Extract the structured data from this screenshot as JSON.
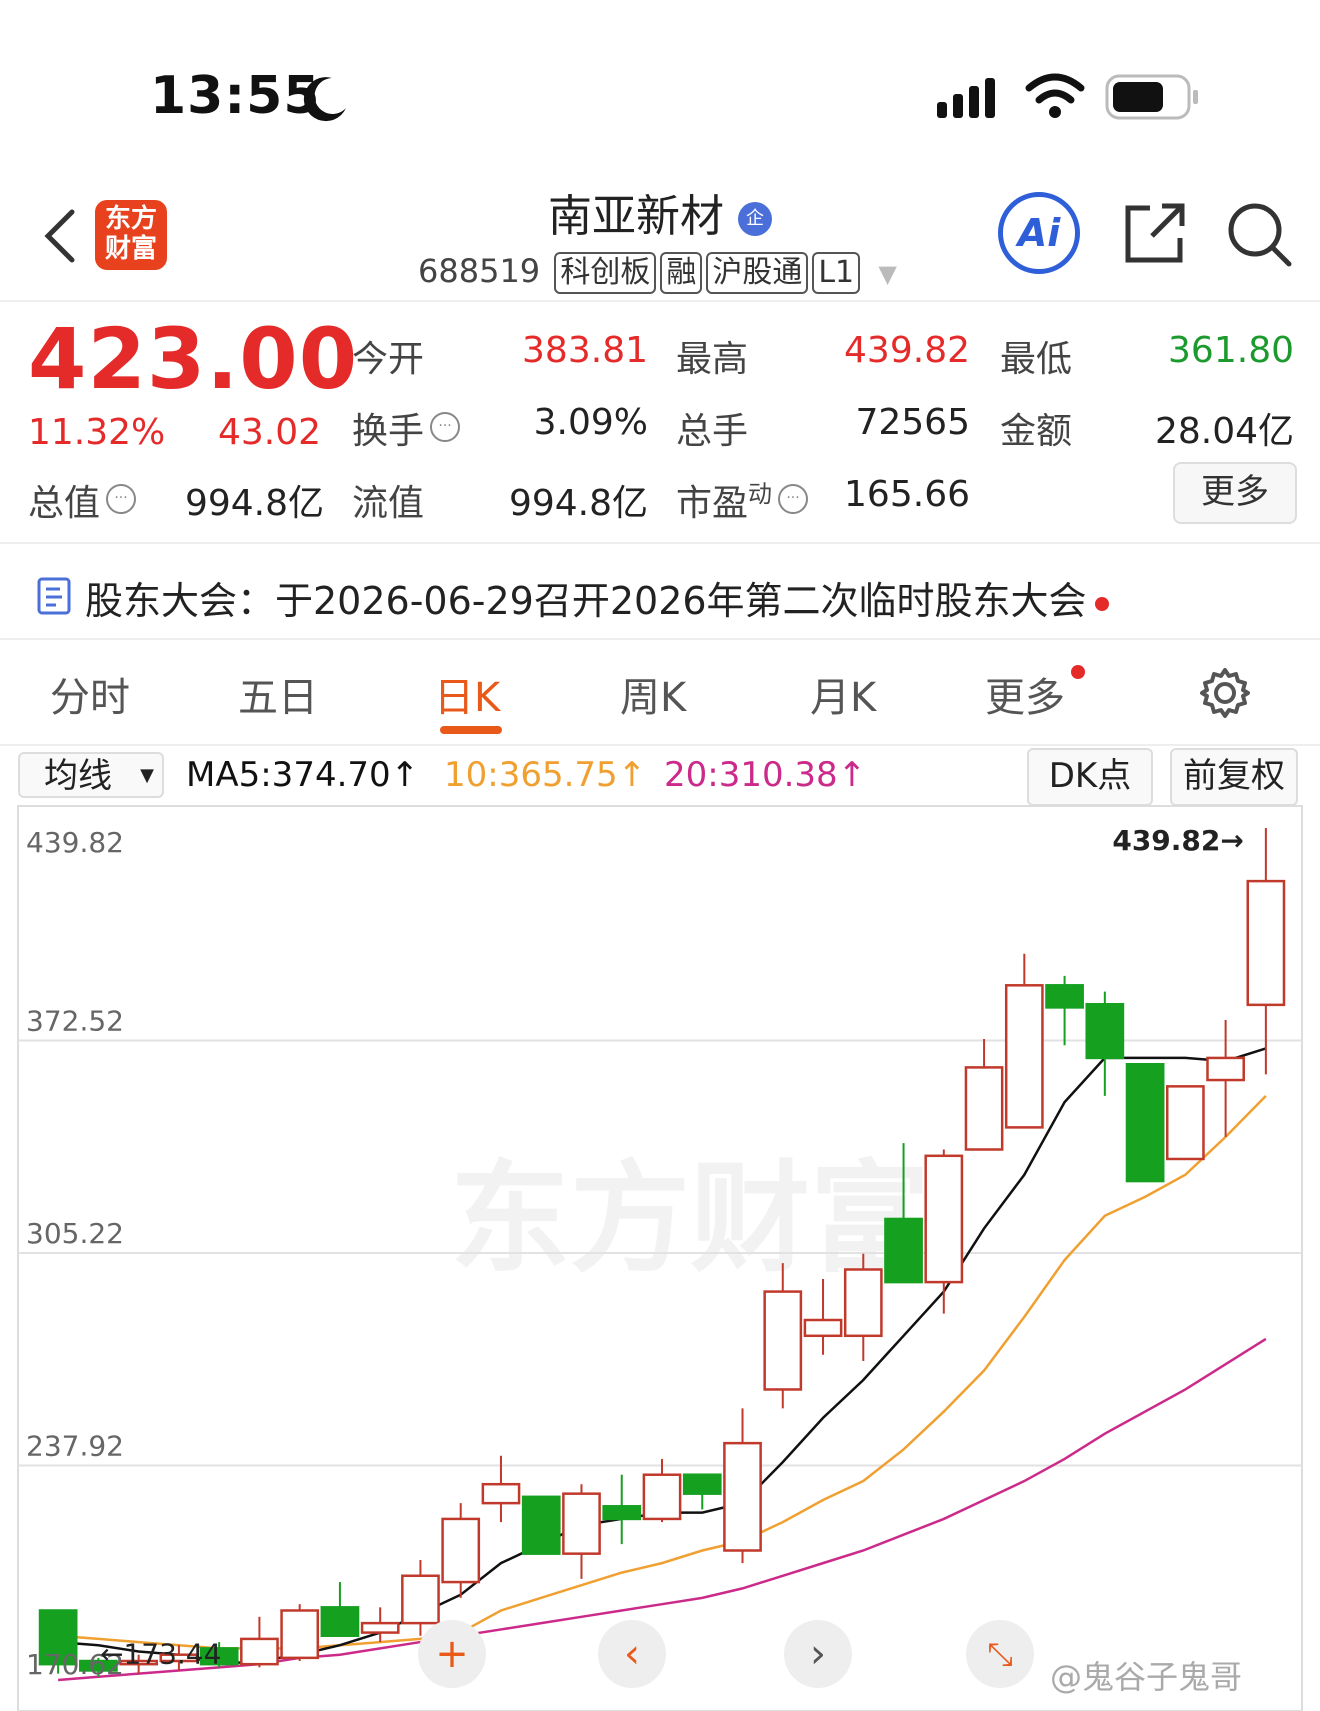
{
  "status_bar": {
    "time": "13:55"
  },
  "header": {
    "logo_text": "东方财富",
    "stock_name": "南亚新材",
    "badge": "企",
    "code": "688519",
    "tags": [
      "科创板",
      "融",
      "沪股通",
      "L1"
    ],
    "ai_label": "Ai"
  },
  "quote": {
    "price": "423.00",
    "change_pct": "11.32%",
    "change_abs": "43.02",
    "open_label": "今开",
    "open_value": "383.81",
    "high_label": "最高",
    "high_value": "439.82",
    "low_label": "最低",
    "low_value": "361.80",
    "turnover_label": "换手",
    "turnover_value": "3.09%",
    "volume_label": "总手",
    "volume_value": "72565",
    "amount_label": "金额",
    "amount_value": "28.04亿",
    "mcap_label": "总值",
    "mcap_value": "994.8亿",
    "float_label": "流值",
    "float_value": "994.8亿",
    "pe_label": "市盈",
    "pe_sup": "动",
    "pe_value": "165.66",
    "more_label": "更多"
  },
  "notice": {
    "text": "股东大会：于2026-06-29召开2026年第二次临时股东大会"
  },
  "tabs": [
    "分时",
    "五日",
    "日K",
    "周K",
    "月K",
    "更多"
  ],
  "active_tab": "日K",
  "toolbar": {
    "indicator": "均线",
    "ma5": "MA5:374.70",
    "ma10": "10:365.75",
    "ma20": "20:310.38",
    "dk_label": "DK点",
    "adjust_label": "前复权"
  },
  "colors": {
    "up": "#c0392b",
    "down": "#15a020",
    "ma5": "#111111",
    "ma10": "#f0a030",
    "ma20": "#cc2a8a",
    "accent": "#e8591a"
  },
  "chart_data": {
    "type": "candlestick",
    "y_ticks": [
      "439.82",
      "372.52",
      "305.22",
      "237.92",
      "170.62"
    ],
    "ylim": [
      170.62,
      439.82
    ],
    "max_label": "439.82",
    "min_label": "173.44",
    "candles": [
      {
        "o": 192,
        "h": 192,
        "l": 172,
        "c": 175
      },
      {
        "o": 176,
        "h": 177,
        "l": 171,
        "c": 173
      },
      {
        "o": 175,
        "h": 178,
        "l": 172,
        "c": 176
      },
      {
        "o": 176,
        "h": 181,
        "l": 173,
        "c": 178
      },
      {
        "o": 180,
        "h": 182,
        "l": 174,
        "c": 175
      },
      {
        "o": 175,
        "h": 190,
        "l": 174,
        "c": 183
      },
      {
        "o": 177,
        "h": 194,
        "l": 176,
        "c": 192
      },
      {
        "o": 193,
        "h": 201,
        "l": 184,
        "c": 184
      },
      {
        "o": 185,
        "h": 193,
        "l": 182,
        "c": 188
      },
      {
        "o": 188,
        "h": 208,
        "l": 184,
        "c": 203
      },
      {
        "o": 201,
        "h": 226,
        "l": 196,
        "c": 221
      },
      {
        "o": 226,
        "h": 241,
        "l": 220,
        "c": 232
      },
      {
        "o": 228,
        "h": 228,
        "l": 210,
        "c": 210
      },
      {
        "o": 210,
        "h": 232,
        "l": 202,
        "c": 229
      },
      {
        "o": 225,
        "h": 235,
        "l": 213,
        "c": 221
      },
      {
        "o": 221,
        "h": 240,
        "l": 220,
        "c": 235
      },
      {
        "o": 235,
        "h": 235,
        "l": 224,
        "c": 229
      },
      {
        "o": 211,
        "h": 256,
        "l": 207,
        "c": 245
      },
      {
        "o": 262,
        "h": 302,
        "l": 256,
        "c": 293
      },
      {
        "o": 279,
        "h": 297,
        "l": 273,
        "c": 284
      },
      {
        "o": 279,
        "h": 305,
        "l": 271,
        "c": 300
      },
      {
        "o": 316,
        "h": 340,
        "l": 296,
        "c": 296
      },
      {
        "o": 296,
        "h": 338,
        "l": 286,
        "c": 336
      },
      {
        "o": 338,
        "h": 373,
        "l": 338,
        "c": 364
      },
      {
        "o": 345,
        "h": 400,
        "l": 345,
        "c": 390
      },
      {
        "o": 390,
        "h": 393,
        "l": 371,
        "c": 383
      },
      {
        "o": 384,
        "h": 388,
        "l": 355,
        "c": 367
      },
      {
        "o": 365,
        "h": 365,
        "l": 328,
        "c": 328
      },
      {
        "o": 335,
        "h": 358,
        "l": 335,
        "c": 358
      },
      {
        "o": 360,
        "h": 379,
        "l": 342,
        "c": 367
      },
      {
        "o": 383.81,
        "h": 439.82,
        "l": 361.8,
        "c": 423.0
      }
    ],
    "ma5": [
      182,
      181,
      179,
      178,
      175,
      176,
      178,
      181,
      185,
      191,
      197,
      207,
      213,
      219,
      221,
      223,
      223,
      226,
      239,
      253,
      265,
      279,
      293,
      313,
      330,
      353,
      367,
      367,
      367,
      366,
      370
    ],
    "ma10": [
      184,
      183,
      182,
      181,
      180,
      180,
      180,
      181,
      182,
      183,
      185,
      192,
      196,
      200,
      204,
      207,
      211,
      214,
      220,
      227,
      233,
      243,
      255,
      268,
      285,
      303,
      317,
      323,
      330,
      342,
      355
    ],
    "ma20": [
      170,
      171,
      172,
      173,
      174,
      175,
      177,
      178,
      180,
      182,
      184,
      186,
      188,
      190,
      192,
      194,
      196,
      199,
      203,
      207,
      211,
      216,
      221,
      227,
      233,
      240,
      248,
      255,
      262,
      270,
      278
    ]
  },
  "watermark": "@鬼谷子鬼哥",
  "bg_watermark": "东方财富"
}
